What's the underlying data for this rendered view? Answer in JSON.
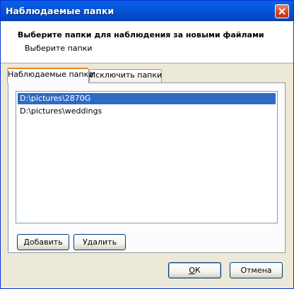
{
  "window": {
    "title": "Наблюдаемые папки"
  },
  "header": {
    "title": "Выберите папки для наблюдения за новыми файлами",
    "subtitle": "Выберите папки"
  },
  "tabs": [
    {
      "label": "Наблюдаемые папки",
      "active": true
    },
    {
      "label": "Исключить папки",
      "active": false
    }
  ],
  "folders": [
    {
      "path": "D:\\pictures\\2870G",
      "selected": true
    },
    {
      "path": "D:\\pictures\\weddings",
      "selected": false
    }
  ],
  "buttons": {
    "add": "Добавить",
    "remove": "Удалить",
    "ok_letter": "О",
    "ok_rest": "К",
    "cancel": "Отмена"
  },
  "colors": {
    "title_bar": "#0458d9",
    "selection": "#316ac5",
    "active_tab_accent": "#e68b2c"
  }
}
